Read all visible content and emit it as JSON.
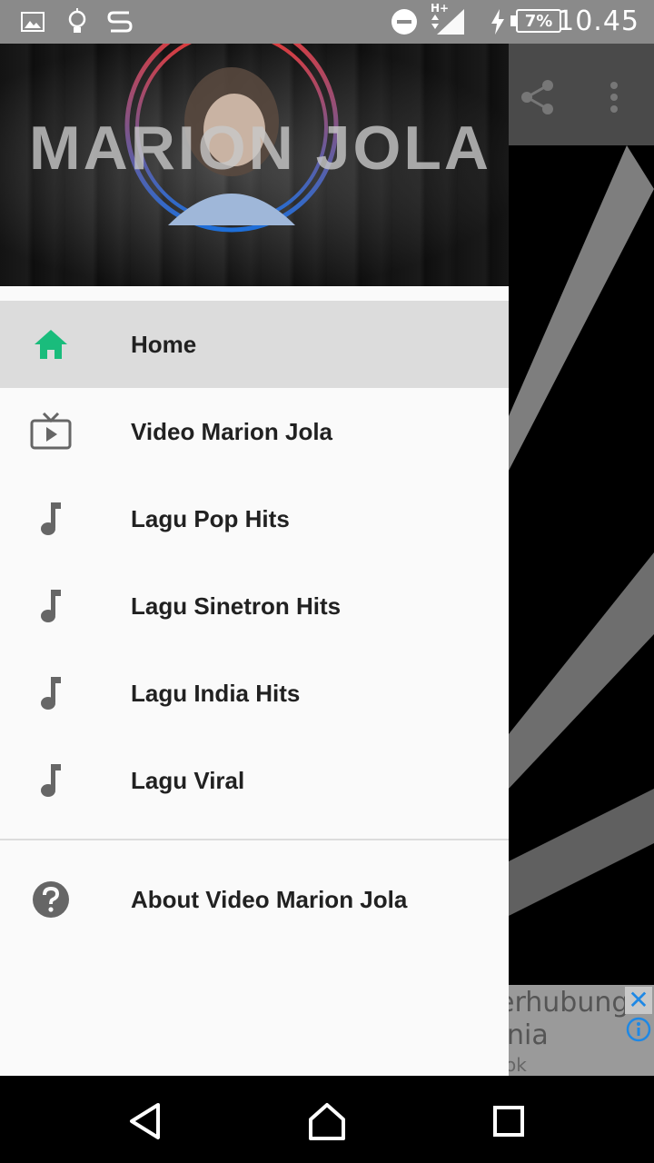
{
  "status_bar": {
    "time": "10.45",
    "battery": "7%",
    "network": "H+",
    "icons": [
      "image-icon",
      "lightbulb-icon",
      "s-app-icon",
      "do-not-disturb-icon",
      "signal-icon",
      "charging-icon",
      "battery-icon"
    ]
  },
  "drawer": {
    "header_title": "MARION JOLA",
    "items": [
      {
        "label": "Home",
        "icon": "home-icon",
        "active": true
      },
      {
        "label": "Video Marion Jola",
        "icon": "tv-play-icon"
      },
      {
        "label": "Lagu Pop Hits",
        "icon": "music-note-icon"
      },
      {
        "label": "Lagu Sinetron Hits",
        "icon": "music-note-icon"
      },
      {
        "label": "Lagu India Hits",
        "icon": "music-note-icon"
      },
      {
        "label": "Lagu Viral",
        "icon": "music-note-icon"
      }
    ],
    "about": {
      "label": "About Video Marion Jola",
      "icon": "help-circle-icon"
    }
  },
  "toolbar": {
    "icons": [
      "share-icon",
      "more-vert-icon"
    ]
  },
  "ad": {
    "line1": "erhubung",
    "line2": "nia",
    "line3": "ok"
  },
  "colors": {
    "accent": "#1abc7c",
    "status_bar": "#8a8a8a",
    "drawer_bg": "#fafafa",
    "active_bg": "#dcdcdc"
  },
  "navbar": {
    "icons": [
      "back-icon",
      "home-nav-icon",
      "recents-icon"
    ]
  }
}
